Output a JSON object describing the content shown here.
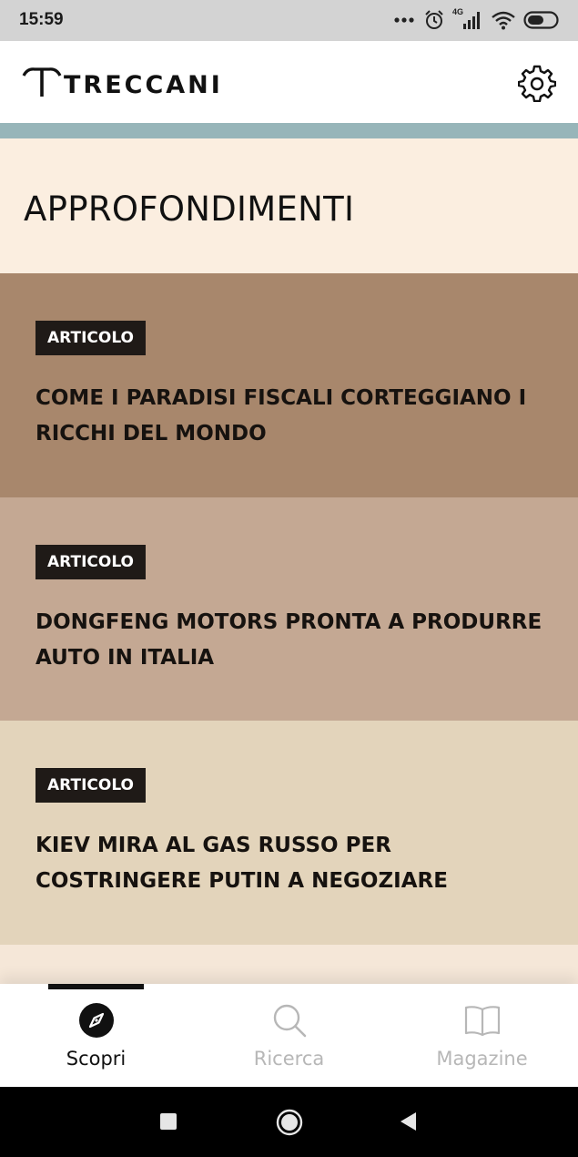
{
  "status_bar": {
    "time": "15:59",
    "network_label": "4G",
    "icons": [
      "more-dots-icon",
      "alarm-icon",
      "signal-4g-icon",
      "wifi-icon",
      "battery-icon"
    ]
  },
  "app": {
    "brand": "TRECCANI",
    "settings_icon": "gear-icon"
  },
  "section": {
    "title": "APPROFONDIMENTI"
  },
  "articles": [
    {
      "badge": "ARTICOLO",
      "title": "COME I PARADISI FISCALI CORTEGGIANO I RICCHI DEL MONDO",
      "color": "#a8876c"
    },
    {
      "badge": "ARTICOLO",
      "title": "DONGFENG MOTORS PRONTA A PRODURRE AUTO IN ITALIA",
      "color": "#c4a893"
    },
    {
      "badge": "ARTICOLO",
      "title": "KIEV MIRA AL GAS RUSSO PER COSTRINGERE PUTIN A NEGOZIARE",
      "color": "#e3d4bb"
    }
  ],
  "tabs": [
    {
      "label": "Scopri",
      "icon": "compass-icon",
      "active": true
    },
    {
      "label": "Ricerca",
      "icon": "search-icon",
      "active": false
    },
    {
      "label": "Magazine",
      "icon": "book-icon",
      "active": false
    }
  ],
  "nav_buttons": [
    "recents-square-icon",
    "home-circle-icon",
    "back-triangle-icon"
  ],
  "colors": {
    "accent_bar": "#97b5b9",
    "background": "#fbeee0",
    "badge_bg": "#1f1a17",
    "tab_active": "#111111",
    "tab_inactive": "#b7b7b7"
  }
}
